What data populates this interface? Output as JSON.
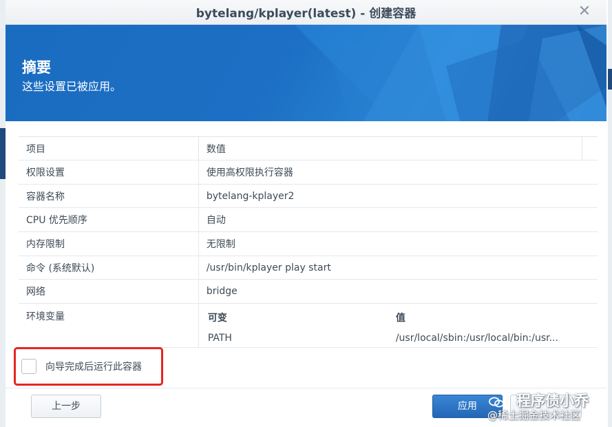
{
  "window": {
    "title": "bytelang/kplayer(latest) - 创建容器",
    "close_glyph": "✕"
  },
  "banner": {
    "title": "摘要",
    "subtitle": "这些设置已被应用。"
  },
  "summary_table": {
    "headers": [
      "项目",
      "数值"
    ],
    "rows": [
      {
        "item": "权限设置",
        "value": "使用高权限执行容器"
      },
      {
        "item": "容器名称",
        "value": "bytelang-kplayer2"
      },
      {
        "item": "CPU 优先顺序",
        "value": "自动"
      },
      {
        "item": "内存限制",
        "value": "无限制"
      },
      {
        "item": "命令 (系统默认)",
        "value": "/usr/bin/kplayer play start"
      },
      {
        "item": "网络",
        "value": "bridge"
      }
    ],
    "env": {
      "item": "环境变量",
      "headers": [
        "可变",
        "值"
      ],
      "rows": [
        {
          "name": "PATH",
          "value": "/usr/local/sbin:/usr/local/bin:/usr..."
        }
      ]
    }
  },
  "run_after_wizard": {
    "label": "向导完成后运行此容器",
    "checked": false
  },
  "footer": {
    "prev_label": "上一步",
    "apply_label": "应用",
    "cancel_label": ""
  },
  "watermark": {
    "line1": "程序债小乔",
    "line2": "@稀土掘金技术社区"
  },
  "colors": {
    "banner_blue": "#1c6fc4",
    "apply_blue": "#2b74c6",
    "highlight_red": "#e8241e"
  }
}
